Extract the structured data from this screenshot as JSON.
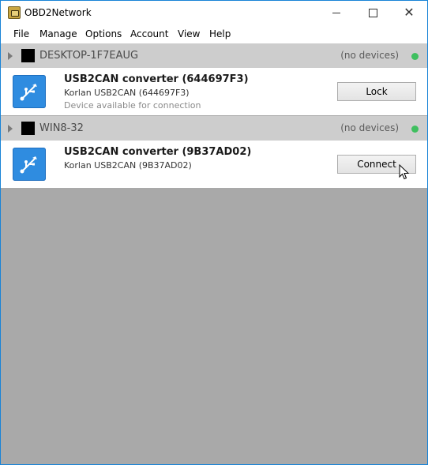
{
  "window": {
    "title": "OBD2Network"
  },
  "menu": [
    "File",
    "Manage",
    "Options",
    "Account",
    "View",
    "Help"
  ],
  "groups": [
    {
      "name": "DESKTOP-1F7EAUG",
      "status": "(no devices)",
      "device": {
        "title": "USB2CAN converter (644697F3)",
        "subtitle": "Korlan USB2CAN (644697F3)",
        "note": "Device available for connection",
        "button": "Lock"
      }
    },
    {
      "name": "WIN8-32",
      "status": "(no devices)",
      "device": {
        "title": "USB2CAN converter (9B37AD02)",
        "subtitle": "Korlan USB2CAN (9B37AD02)",
        "button": "Connect"
      }
    }
  ],
  "colors": {
    "window_border": "#1883d7",
    "background": "#a9a9a9",
    "group_header": "#cdcdcd",
    "status_dot": "#3fbf5f",
    "usb_icon": "#2f8ce0"
  },
  "icons": [
    "app-icon",
    "minimize-icon",
    "maximize-icon",
    "close-icon",
    "expand-arrow-icon",
    "usb-icon",
    "status-dot-icon",
    "mouse-cursor-icon"
  ]
}
